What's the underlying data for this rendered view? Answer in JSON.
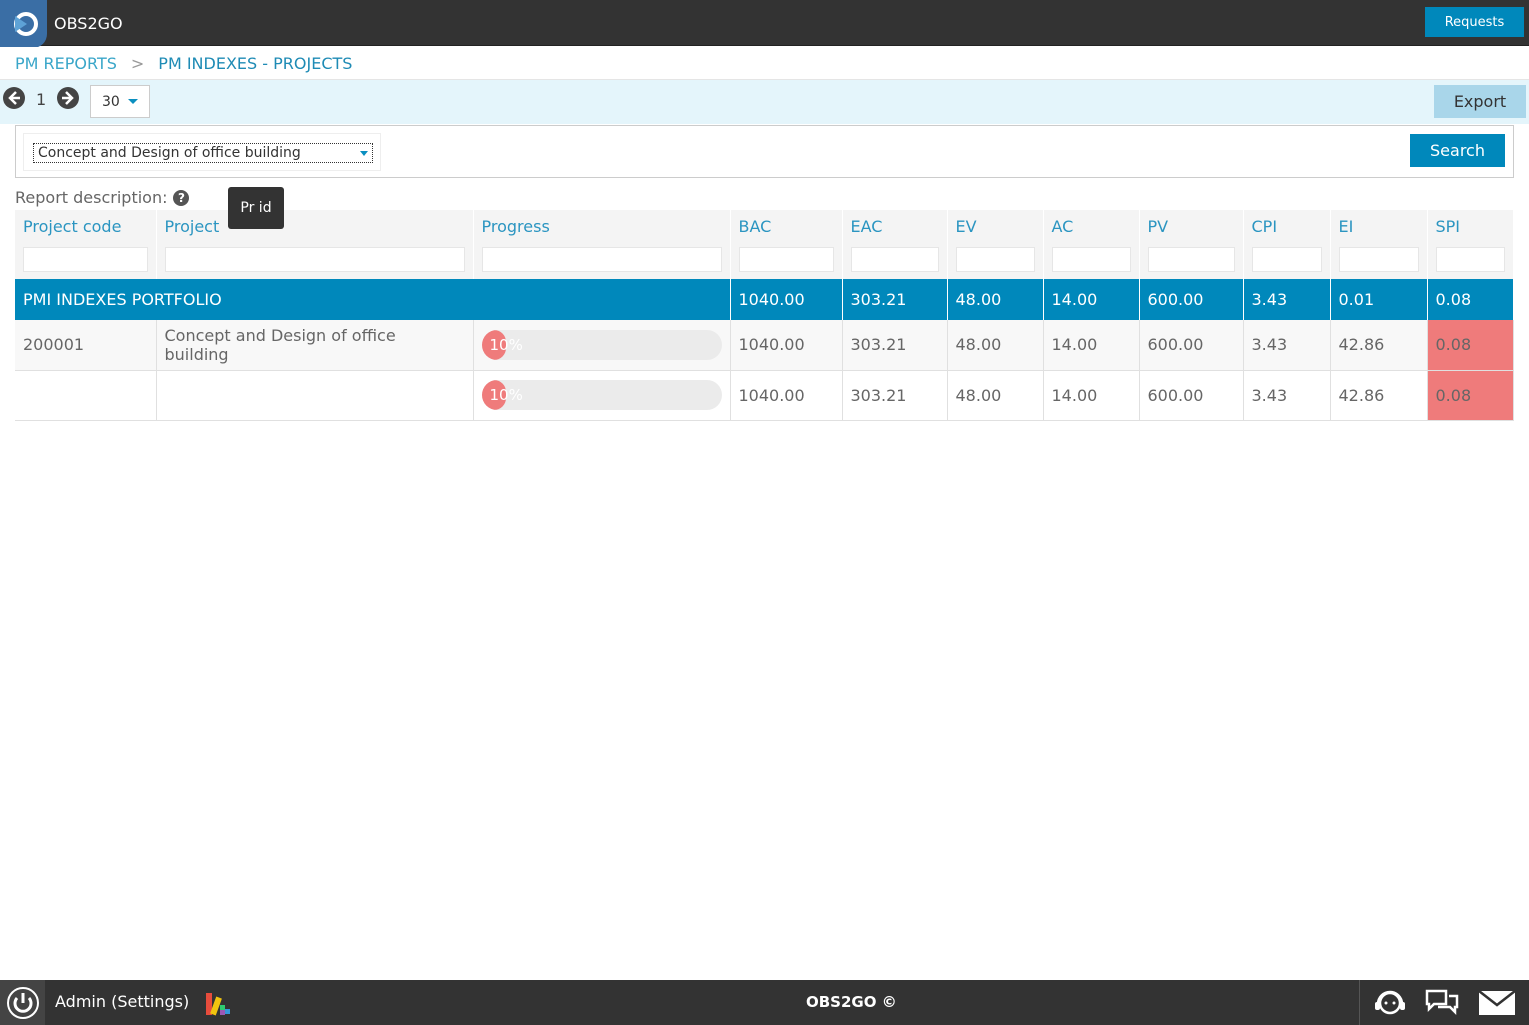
{
  "app": {
    "title": "OBS2GO"
  },
  "header": {
    "requests_label": "Requests"
  },
  "breadcrumb": {
    "parent": "PM REPORTS",
    "separator": ">",
    "current": "PM INDEXES - PROJECTS"
  },
  "pager": {
    "page": "1",
    "page_size": "30",
    "export_label": "Export"
  },
  "filter": {
    "project_selected": "Concept and Design of office building",
    "search_label": "Search"
  },
  "report": {
    "description_label": "Report description:",
    "help_glyph": "?",
    "tooltip": "Pr id"
  },
  "table": {
    "headers": [
      "Project code",
      "Project",
      "Progress",
      "BAC",
      "EAC",
      "EV",
      "AC",
      "PV",
      "CPI",
      "EI",
      "SPI"
    ],
    "portfolio": {
      "name": "PMI INDEXES PORTFOLIO",
      "bac": "1040.00",
      "eac": "303.21",
      "ev": "48.00",
      "ac": "14.00",
      "pv": "600.00",
      "cpi": "3.43",
      "ei": "0.01",
      "spi": "0.08"
    },
    "rows": [
      {
        "code": "200001",
        "project": "Concept and Design of office building",
        "progress_text": "10%",
        "progress": 0.1,
        "bac": "1040.00",
        "eac": "303.21",
        "ev": "48.00",
        "ac": "14.00",
        "pv": "600.00",
        "cpi": "3.43",
        "ei": "42.86",
        "spi": "0.08"
      },
      {
        "code": "",
        "project": "",
        "progress_text": "10%",
        "progress": 0.1,
        "bac": "1040.00",
        "eac": "303.21",
        "ev": "48.00",
        "ac": "14.00",
        "pv": "600.00",
        "cpi": "3.43",
        "ei": "42.86",
        "spi": "0.08"
      }
    ]
  },
  "colors": {
    "accent": "#0088bb",
    "header_bar": "#333333",
    "spi_alert": "#ef7b7b",
    "link": "#2b95c1"
  },
  "footer": {
    "user_label": "Admin (Settings)",
    "brand": "OBS2GO ©"
  },
  "icons": [
    "app-logo-icon",
    "arrow-left-icon",
    "arrow-right-icon",
    "chevron-down-icon",
    "help-icon",
    "power-icon",
    "palette-icon",
    "support-headset-icon",
    "chat-icon",
    "mail-icon"
  ]
}
